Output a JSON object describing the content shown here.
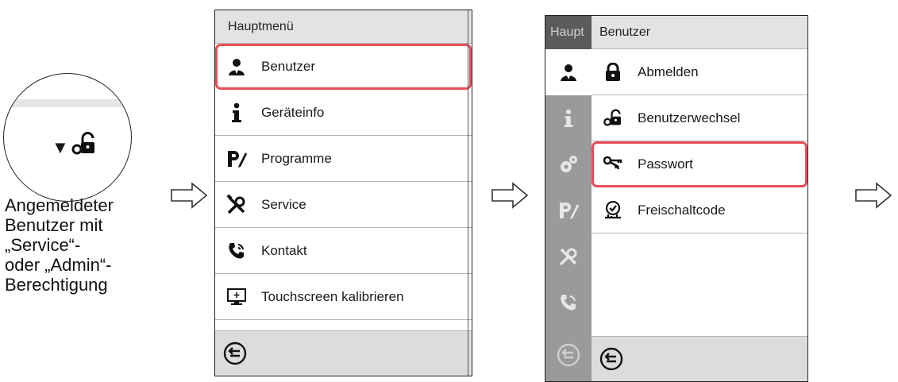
{
  "status": {
    "caption_lines": [
      "Angemeldeter",
      "Benutzer mit",
      "„Service“-",
      "oder „Admin“-",
      "Berechtigung"
    ],
    "icons": [
      "dropdown-triangle-icon",
      "key-lock-icon"
    ]
  },
  "main_menu": {
    "title": "Hauptmenü",
    "items": [
      {
        "label": "Benutzer",
        "icon": "user-icon"
      },
      {
        "label": "Geräteinfo",
        "icon": "info-icon"
      },
      {
        "label": "Programme",
        "icon": "program-icon"
      },
      {
        "label": "Service",
        "icon": "tools-icon"
      },
      {
        "label": "Kontakt",
        "icon": "phone-icon"
      },
      {
        "label": "Touchscreen kalibrieren",
        "icon": "touchscreen-icon"
      }
    ],
    "selected_index": 0
  },
  "user_menu": {
    "rail_title": "Haupt",
    "title": "Benutzer",
    "items": [
      {
        "label": "Abmelden",
        "icon": "lock-icon"
      },
      {
        "label": "Benutzerwechsel",
        "icon": "key-lock-icon"
      },
      {
        "label": "Passwort",
        "icon": "keys-icon"
      },
      {
        "label": "Freischaltcode",
        "icon": "code-key-icon"
      }
    ],
    "selected_index": 2,
    "rail_icons": [
      "user-icon",
      "info-icon",
      "gears-icon",
      "program-icon",
      "tools-icon",
      "phone-icon"
    ]
  },
  "colors": {
    "highlight": "#e84f5a",
    "header_bg": "#e3e3e3",
    "rail_bg": "#9a9a9a",
    "footer_bg": "#dcdcdc"
  }
}
